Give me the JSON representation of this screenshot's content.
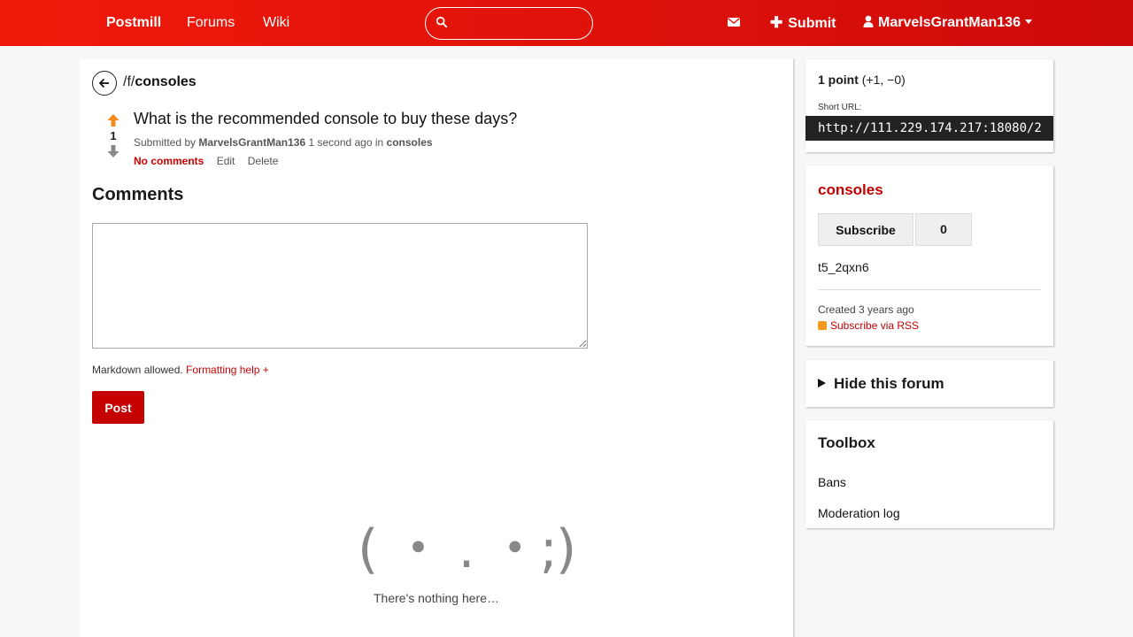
{
  "nav": {
    "brand": "Postmill",
    "forums": "Forums",
    "wiki": "Wiki",
    "search_placeholder": "",
    "submit": "Submit",
    "username": "MarvelsGrantMan136"
  },
  "post": {
    "forum_prefix": "/f/",
    "forum": "consoles",
    "score": "1",
    "title": "What is the recommended console to buy these days?",
    "submitted_by": "Submitted by",
    "author": "MarvelsGrantMan136",
    "time": "1 second ago in",
    "forum_link": "consoles",
    "actions": {
      "comments": "No comments",
      "edit": "Edit",
      "delete": "Delete"
    }
  },
  "comments": {
    "heading": "Comments",
    "markdown_note": "Markdown allowed.",
    "formatting_help": "Formatting help +",
    "post_button": "Post",
    "empty_face": "( ・ . ・;)",
    "empty_text": "There's nothing here…"
  },
  "sidebar": {
    "points_bold": "1 point",
    "points_detail": "(+1, −0)",
    "short_url_label": "Short URL:",
    "short_url": "http://111.229.174.217:18080/2",
    "forum_name": "consoles",
    "subscribe": "Subscribe",
    "subscriber_count": "0",
    "forum_description": "t5_2qxn6",
    "created": "Created 3 years ago",
    "rss": "Subscribe via RSS",
    "hide_forum": "Hide this forum",
    "toolbox_heading": "Toolbox",
    "toolbox_items": [
      "Bans",
      "Moderation log"
    ]
  },
  "colors": {
    "accent": "#c40000",
    "nav_start": "#f01a0a",
    "nav_end": "#cc0a0a",
    "upvote": "#f48a1c"
  }
}
